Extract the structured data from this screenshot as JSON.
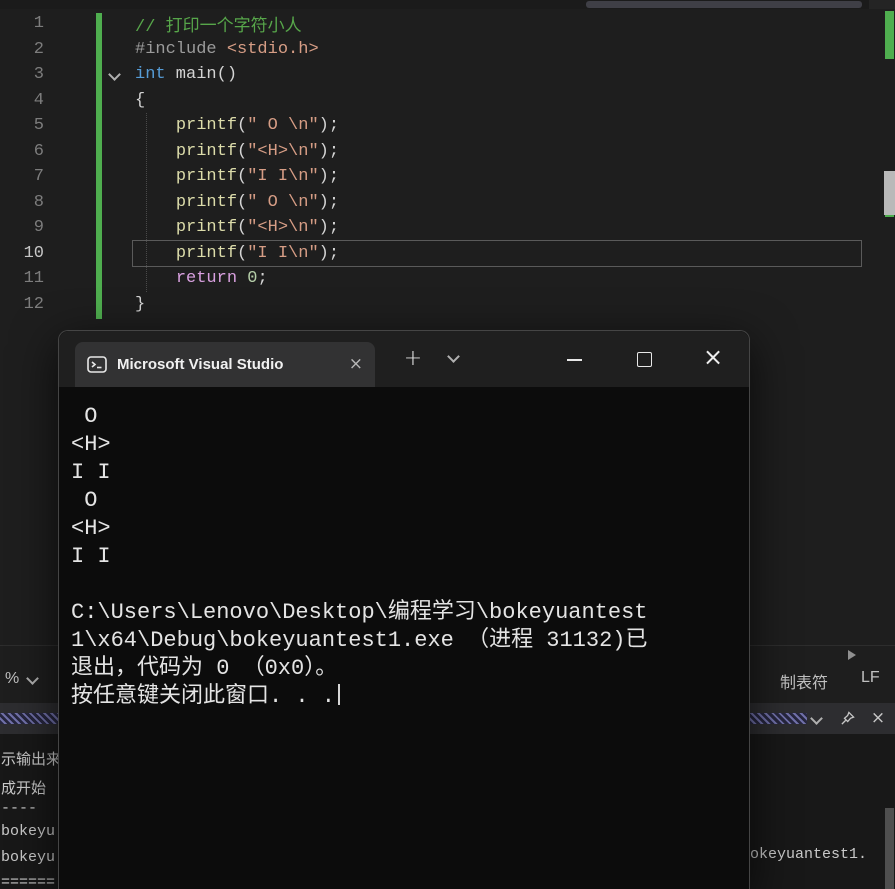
{
  "colors": {
    "change_indicator_green": "#4fae4f",
    "comment_green": "#57a64a",
    "console_background": "#0c0c0c"
  },
  "editor": {
    "current_line": 10,
    "code_lines": [
      {
        "num": "1",
        "segs": [
          [
            "comment",
            "// 打印一个字符小人"
          ]
        ]
      },
      {
        "num": "2",
        "segs": [
          [
            "preproc",
            "#include "
          ],
          [
            "string",
            "<stdio.h>"
          ]
        ]
      },
      {
        "num": "3",
        "fold": true,
        "segs": [
          [
            "keyword",
            "int"
          ],
          [
            "plain",
            " main()"
          ]
        ]
      },
      {
        "num": "4",
        "segs": [
          [
            "plain",
            "{"
          ]
        ]
      },
      {
        "num": "5",
        "segs": [
          [
            "plain",
            "    "
          ],
          [
            "func",
            "printf"
          ],
          [
            "plain",
            "("
          ],
          [
            "string",
            "\" O \\n\""
          ],
          [
            "plain",
            ");"
          ]
        ]
      },
      {
        "num": "6",
        "segs": [
          [
            "plain",
            "    "
          ],
          [
            "func",
            "printf"
          ],
          [
            "plain",
            "("
          ],
          [
            "string",
            "\"<H>\\n\""
          ],
          [
            "plain",
            ");"
          ]
        ]
      },
      {
        "num": "7",
        "segs": [
          [
            "plain",
            "    "
          ],
          [
            "func",
            "printf"
          ],
          [
            "plain",
            "("
          ],
          [
            "string",
            "\"I I\\n\""
          ],
          [
            "plain",
            ");"
          ]
        ]
      },
      {
        "num": "8",
        "segs": [
          [
            "plain",
            "    "
          ],
          [
            "func",
            "printf"
          ],
          [
            "plain",
            "("
          ],
          [
            "string",
            "\" O \\n\""
          ],
          [
            "plain",
            ");"
          ]
        ]
      },
      {
        "num": "9",
        "segs": [
          [
            "plain",
            "    "
          ],
          [
            "func",
            "printf"
          ],
          [
            "plain",
            "("
          ],
          [
            "string",
            "\"<H>\\n\""
          ],
          [
            "plain",
            ");"
          ]
        ]
      },
      {
        "num": "10",
        "segs": [
          [
            "plain",
            "    "
          ],
          [
            "func",
            "printf"
          ],
          [
            "plain",
            "("
          ],
          [
            "string",
            "\"I I\\n\""
          ],
          [
            "plain",
            ");"
          ]
        ]
      },
      {
        "num": "11",
        "segs": [
          [
            "plain",
            "    "
          ],
          [
            "ctrl",
            "return"
          ],
          [
            "number",
            " 0"
          ],
          [
            "plain",
            ";"
          ]
        ]
      },
      {
        "num": "12",
        "segs": [
          [
            "plain",
            "}"
          ]
        ]
      }
    ]
  },
  "console": {
    "title": "Microsoft Visual Studio",
    "new_tab_label": "+",
    "lines": [
      " O",
      "<H>",
      "I I",
      " O",
      "<H>",
      "I I",
      "",
      "C:\\Users\\Lenovo\\Desktop\\编程学习\\bokeyuantest",
      "1\\x64\\Debug\\bokeyuantest1.exe （进程 31132)已",
      "退出，代码为 0 （0x0）。",
      "按任意键关闭此窗口. . ."
    ]
  },
  "statusbar": {
    "zoom_label": "%",
    "separator": "|",
    "tabs_item": "制表符",
    "eol_item": "LF"
  },
  "output_panel": {
    "left_fragments": [
      "示输出来",
      "成开始",
      "----",
      "bokeyu",
      "bokeyu",
      "======"
    ],
    "right_fragment": "okeyuantest1."
  }
}
